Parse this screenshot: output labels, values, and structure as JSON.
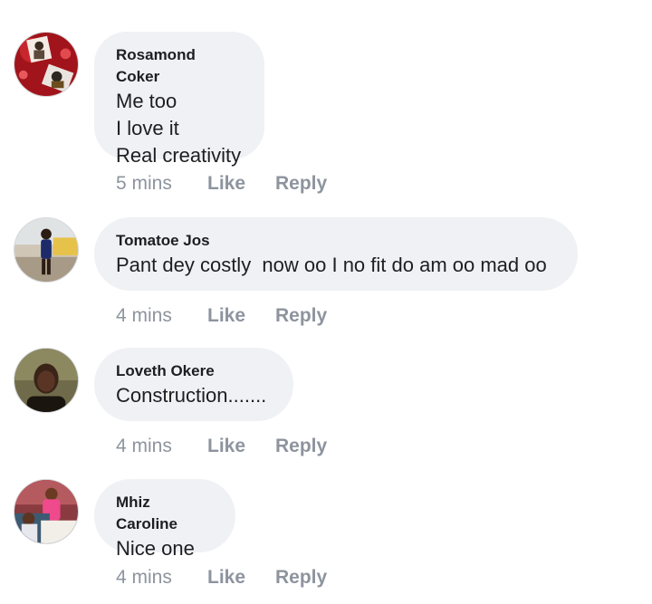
{
  "comments": [
    {
      "author": "Rosamond Coker",
      "lines": [
        "Me too",
        "I love it",
        "Real creativity"
      ],
      "time": "5 mins",
      "like_label": "Like",
      "reply_label": "Reply"
    },
    {
      "author": "Tomatoe Jos",
      "lines": [
        "Pant dey costly  now oo I no fit do am oo mad oo"
      ],
      "time": "4 mins",
      "like_label": "Like",
      "reply_label": "Reply"
    },
    {
      "author": "Loveth Okere",
      "lines": [
        "Construction......."
      ],
      "time": "4 mins",
      "like_label": "Like",
      "reply_label": "Reply"
    },
    {
      "author": "Mhiz Caroline",
      "lines": [
        "Nice one"
      ],
      "time": "4 mins",
      "like_label": "Like",
      "reply_label": "Reply"
    }
  ],
  "colors": {
    "bubble_bg": "#eff1f4",
    "text": "#1c1e21",
    "meta": "#8d949e"
  }
}
